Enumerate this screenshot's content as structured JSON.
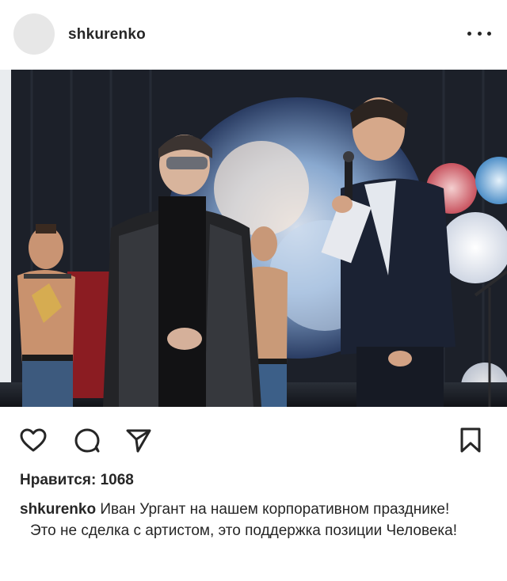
{
  "post": {
    "username": "shkurenko",
    "menu_icon": "more-horizontal-icon",
    "photo_alt": "",
    "likes_text": "Нравится: 1068",
    "caption": {
      "username": "shkurenko",
      "text_line1": " Иван Ургант на нашем корпоративном празднике!",
      "text_line2": "Это не сделка с артистом, это поддержка позиции Человека!"
    }
  },
  "actions": {
    "like_icon": "heart-icon",
    "comment_icon": "comment-icon",
    "share_icon": "send-icon",
    "save_icon": "bookmark-icon"
  },
  "colors": {
    "text": "#262626",
    "avatar_placeholder": "#e7e7e7",
    "photo_background": "#1a1d24"
  }
}
